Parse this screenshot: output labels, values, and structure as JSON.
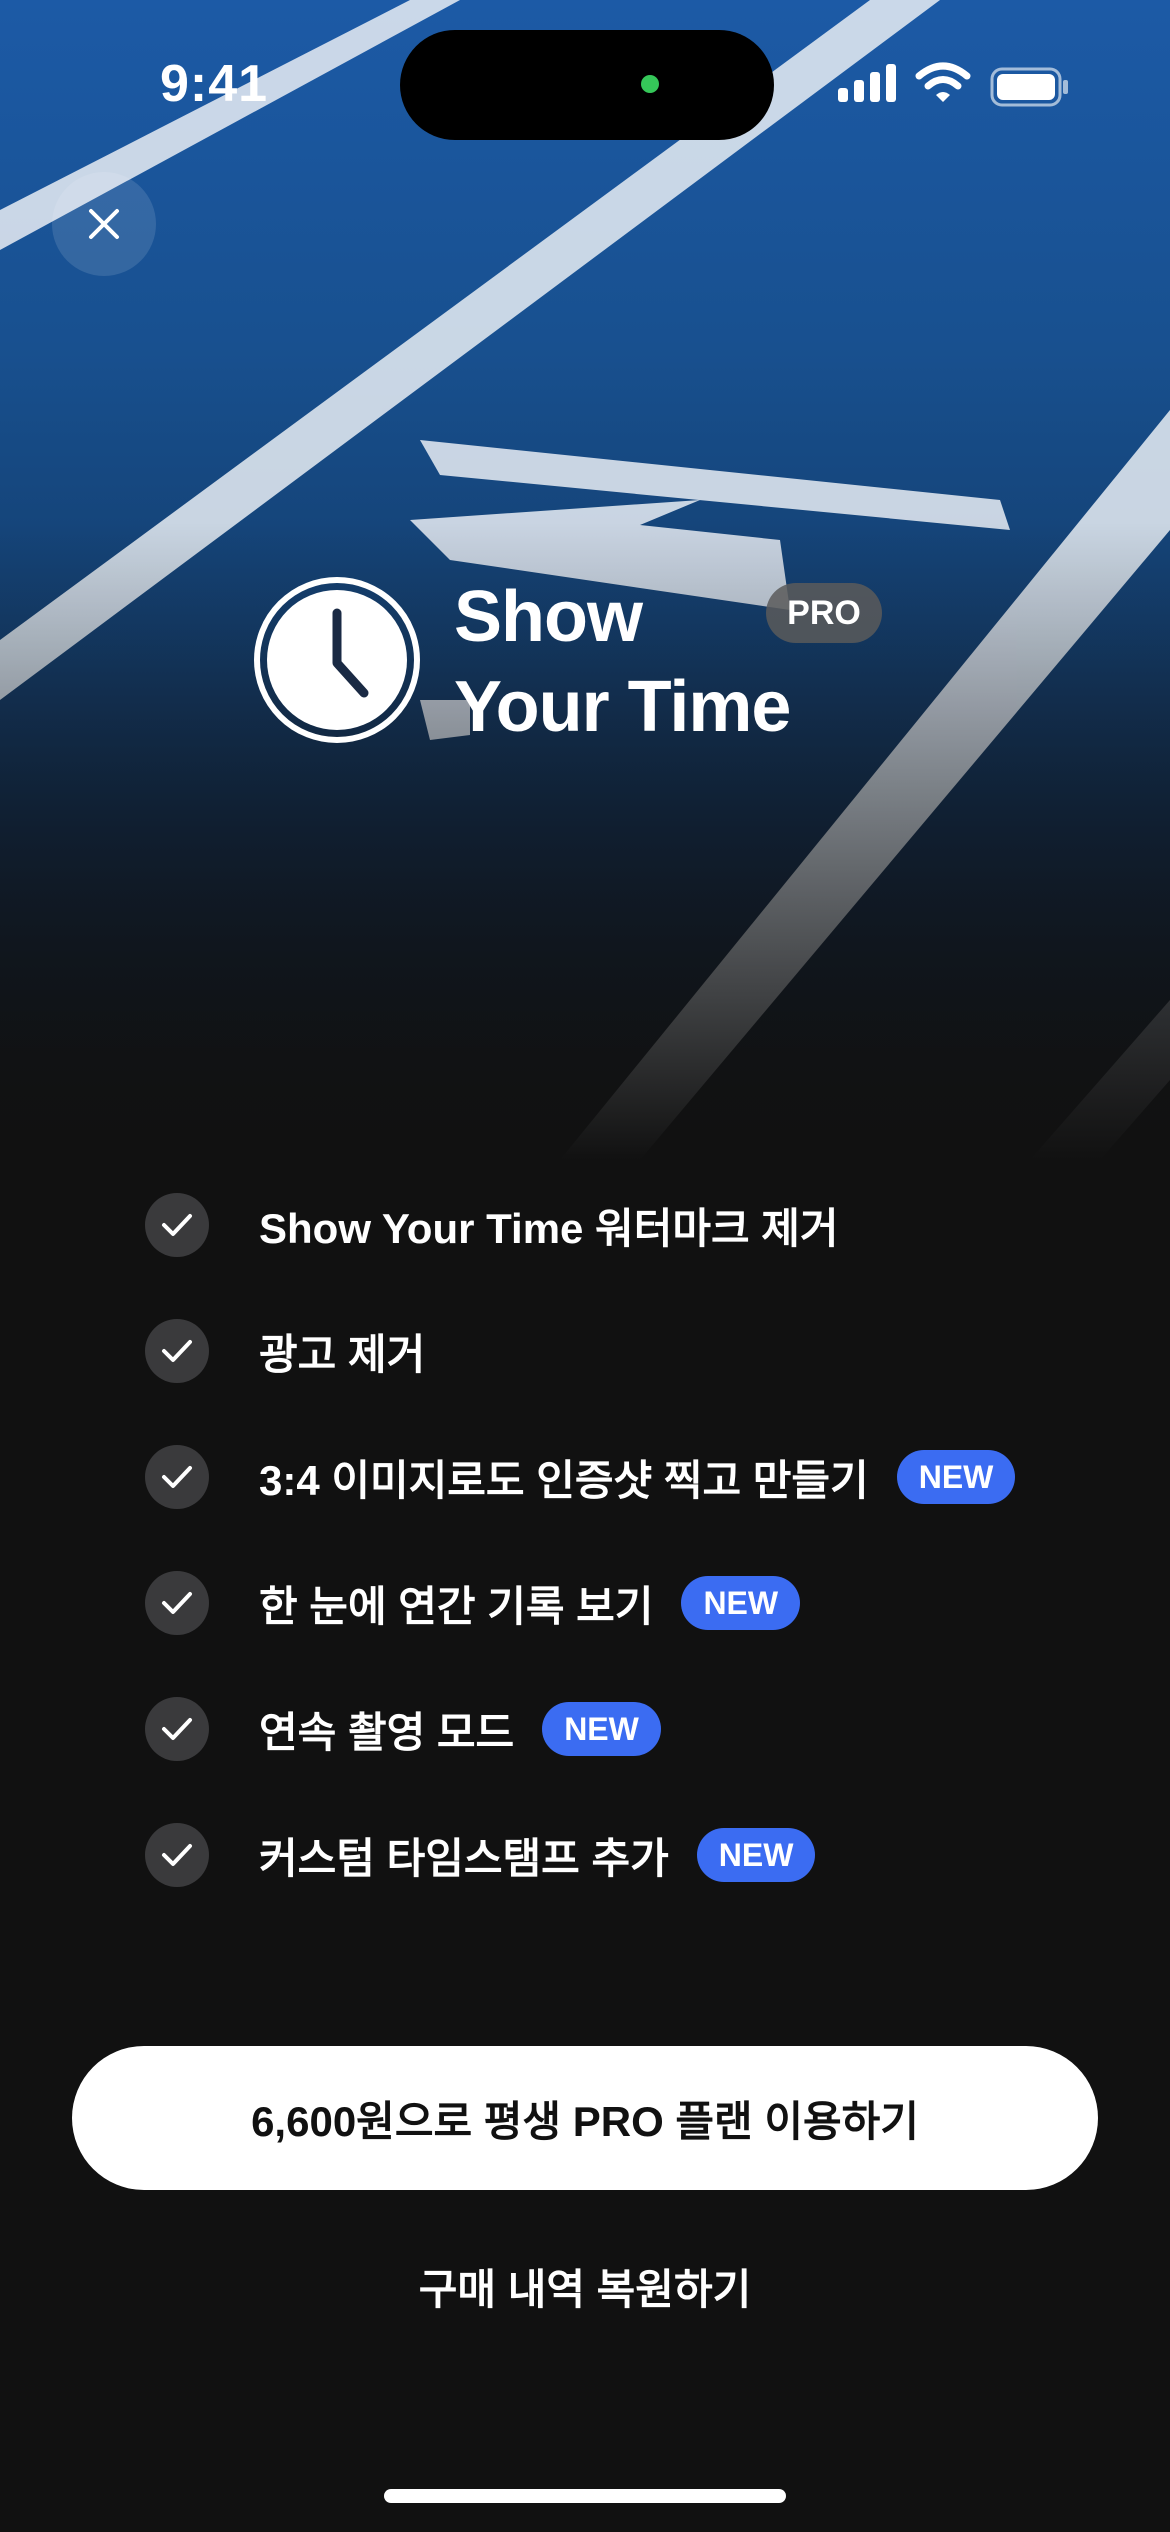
{
  "status_bar": {
    "time": "9:41",
    "signal_icon": "cellular-signal-icon",
    "wifi_icon": "wifi-icon",
    "battery_icon": "battery-icon"
  },
  "close_icon": "close-icon",
  "logo": {
    "icon": "clock-icon",
    "title_line1": "Show",
    "title_line2": "Your Time",
    "badge": "PRO"
  },
  "features": [
    {
      "label": "Show Your Time 워터마크 제거",
      "badge": ""
    },
    {
      "label": "광고 제거",
      "badge": ""
    },
    {
      "label": "3:4 이미지로도 인증샷 찍고 만들기",
      "badge": "NEW"
    },
    {
      "label": "한 눈에 연간 기록 보기",
      "badge": "NEW"
    },
    {
      "label": "연속 촬영 모드",
      "badge": "NEW"
    },
    {
      "label": "커스텀 타임스탬프 추가",
      "badge": "NEW"
    }
  ],
  "cta": {
    "label": "6,600원으로 평생 PRO 플랜 이용하기"
  },
  "restore": {
    "label": "구매 내역 복원하기"
  },
  "colors": {
    "background": "#111111",
    "accent_badge": "#3b6cf2",
    "track_blue": "#1c5aa6",
    "cta_background": "#ffffff"
  }
}
